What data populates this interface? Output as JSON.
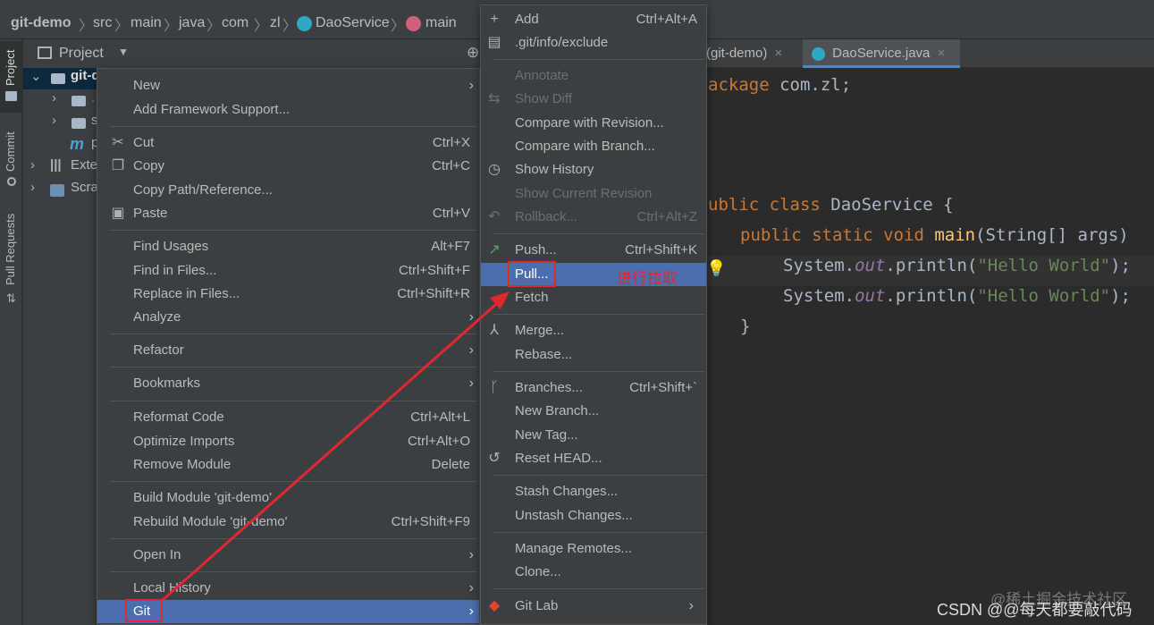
{
  "breadcrumb": [
    "git-demo",
    "src",
    "main",
    "java",
    "com",
    "zl",
    "DaoService",
    "main"
  ],
  "tool_strip": [
    "Project",
    "Commit",
    "Pull Requests"
  ],
  "project_panel": {
    "title": "Project",
    "tree": [
      "git-d",
      ".",
      "s",
      "p",
      "Exte",
      "Scra"
    ]
  },
  "editor": {
    "tabs": [
      "(git-demo)",
      "DaoService.java"
    ],
    "lines": [
      {
        "a": "ackage ",
        "b": "com.zl;"
      },
      {
        "a": "ublic class ",
        "b": "DaoService {"
      },
      {
        "indent": "    ",
        "k1": "public static void ",
        "f": "main",
        "r": "(String[] args)"
      },
      {
        "indent": "      ",
        "c": "System.",
        "o": "out",
        "p": ".println(",
        "s": "\"Hello World\"",
        "e": ");"
      },
      {
        "indent": "      ",
        "c": "System.",
        "o": "out",
        "p": ".println(",
        "s": "\"Hello World\"",
        "e": ");"
      },
      {
        "indent": "    ",
        "c": "}"
      }
    ]
  },
  "context_menu": [
    {
      "label": "New",
      "submenu": true
    },
    {
      "label": "Add Framework Support..."
    },
    {
      "label": "Cut",
      "shortcut": "Ctrl+X",
      "icon": "scissors-icon"
    },
    {
      "label": "Copy",
      "shortcut": "Ctrl+C",
      "icon": "copy-icon"
    },
    {
      "label": "Copy Path/Reference..."
    },
    {
      "label": "Paste",
      "shortcut": "Ctrl+V",
      "icon": "clipboard-icon"
    },
    {
      "label": "Find Usages",
      "shortcut": "Alt+F7"
    },
    {
      "label": "Find in Files...",
      "shortcut": "Ctrl+Shift+F"
    },
    {
      "label": "Replace in Files...",
      "shortcut": "Ctrl+Shift+R"
    },
    {
      "label": "Analyze",
      "submenu": true
    },
    {
      "label": "Refactor",
      "submenu": true
    },
    {
      "label": "Bookmarks",
      "submenu": true
    },
    {
      "label": "Reformat Code",
      "shortcut": "Ctrl+Alt+L"
    },
    {
      "label": "Optimize Imports",
      "shortcut": "Ctrl+Alt+O"
    },
    {
      "label": "Remove Module",
      "shortcut": "Delete"
    },
    {
      "label": "Build Module 'git-demo'"
    },
    {
      "label": "Rebuild Module 'git-demo'",
      "shortcut": "Ctrl+Shift+F9"
    },
    {
      "label": "Open In",
      "submenu": true
    },
    {
      "label": "Local History",
      "submenu": true
    },
    {
      "label": "Git",
      "submenu": true,
      "selected": true
    }
  ],
  "git_menu": [
    {
      "label": "Add",
      "shortcut": "Ctrl+Alt+A",
      "icon": "plus-icon"
    },
    {
      "label": ".git/info/exclude",
      "icon": "git-file-icon"
    },
    {
      "label": "Annotate",
      "disabled": true
    },
    {
      "label": "Show Diff",
      "disabled": true,
      "icon": "diff-icon"
    },
    {
      "label": "Compare with Revision..."
    },
    {
      "label": "Compare with Branch..."
    },
    {
      "label": "Show History",
      "icon": "history-icon"
    },
    {
      "label": "Show Current Revision",
      "disabled": true
    },
    {
      "label": "Rollback...",
      "shortcut": "Ctrl+Alt+Z",
      "disabled": true,
      "icon": "rollback-icon"
    },
    {
      "label": "Push...",
      "shortcut": "Ctrl+Shift+K",
      "icon": "push-arrow-icon"
    },
    {
      "label": "Pull...",
      "selected": true
    },
    {
      "label": "Fetch"
    },
    {
      "label": "Merge...",
      "icon": "merge-icon"
    },
    {
      "label": "Rebase..."
    },
    {
      "label": "Branches...",
      "shortcut": "Ctrl+Shift+`",
      "icon": "branch-icon"
    },
    {
      "label": "New Branch..."
    },
    {
      "label": "New Tag..."
    },
    {
      "label": "Reset HEAD...",
      "icon": "reset-icon"
    },
    {
      "label": "Stash Changes..."
    },
    {
      "label": "Unstash Changes..."
    },
    {
      "label": "Manage Remotes..."
    },
    {
      "label": "Clone..."
    },
    {
      "label": "Git Lab",
      "submenu": true,
      "icon": "gitlab-icon"
    }
  ],
  "annotation": "进行拉取",
  "watermark": "CSDN @@每天都要敲代码",
  "watermark2": "@稀土掘金技术社区",
  "colors": {
    "selection": "#4b6eaf",
    "highlight_box": "#e0282e",
    "menu_bg": "#3c3f41"
  }
}
